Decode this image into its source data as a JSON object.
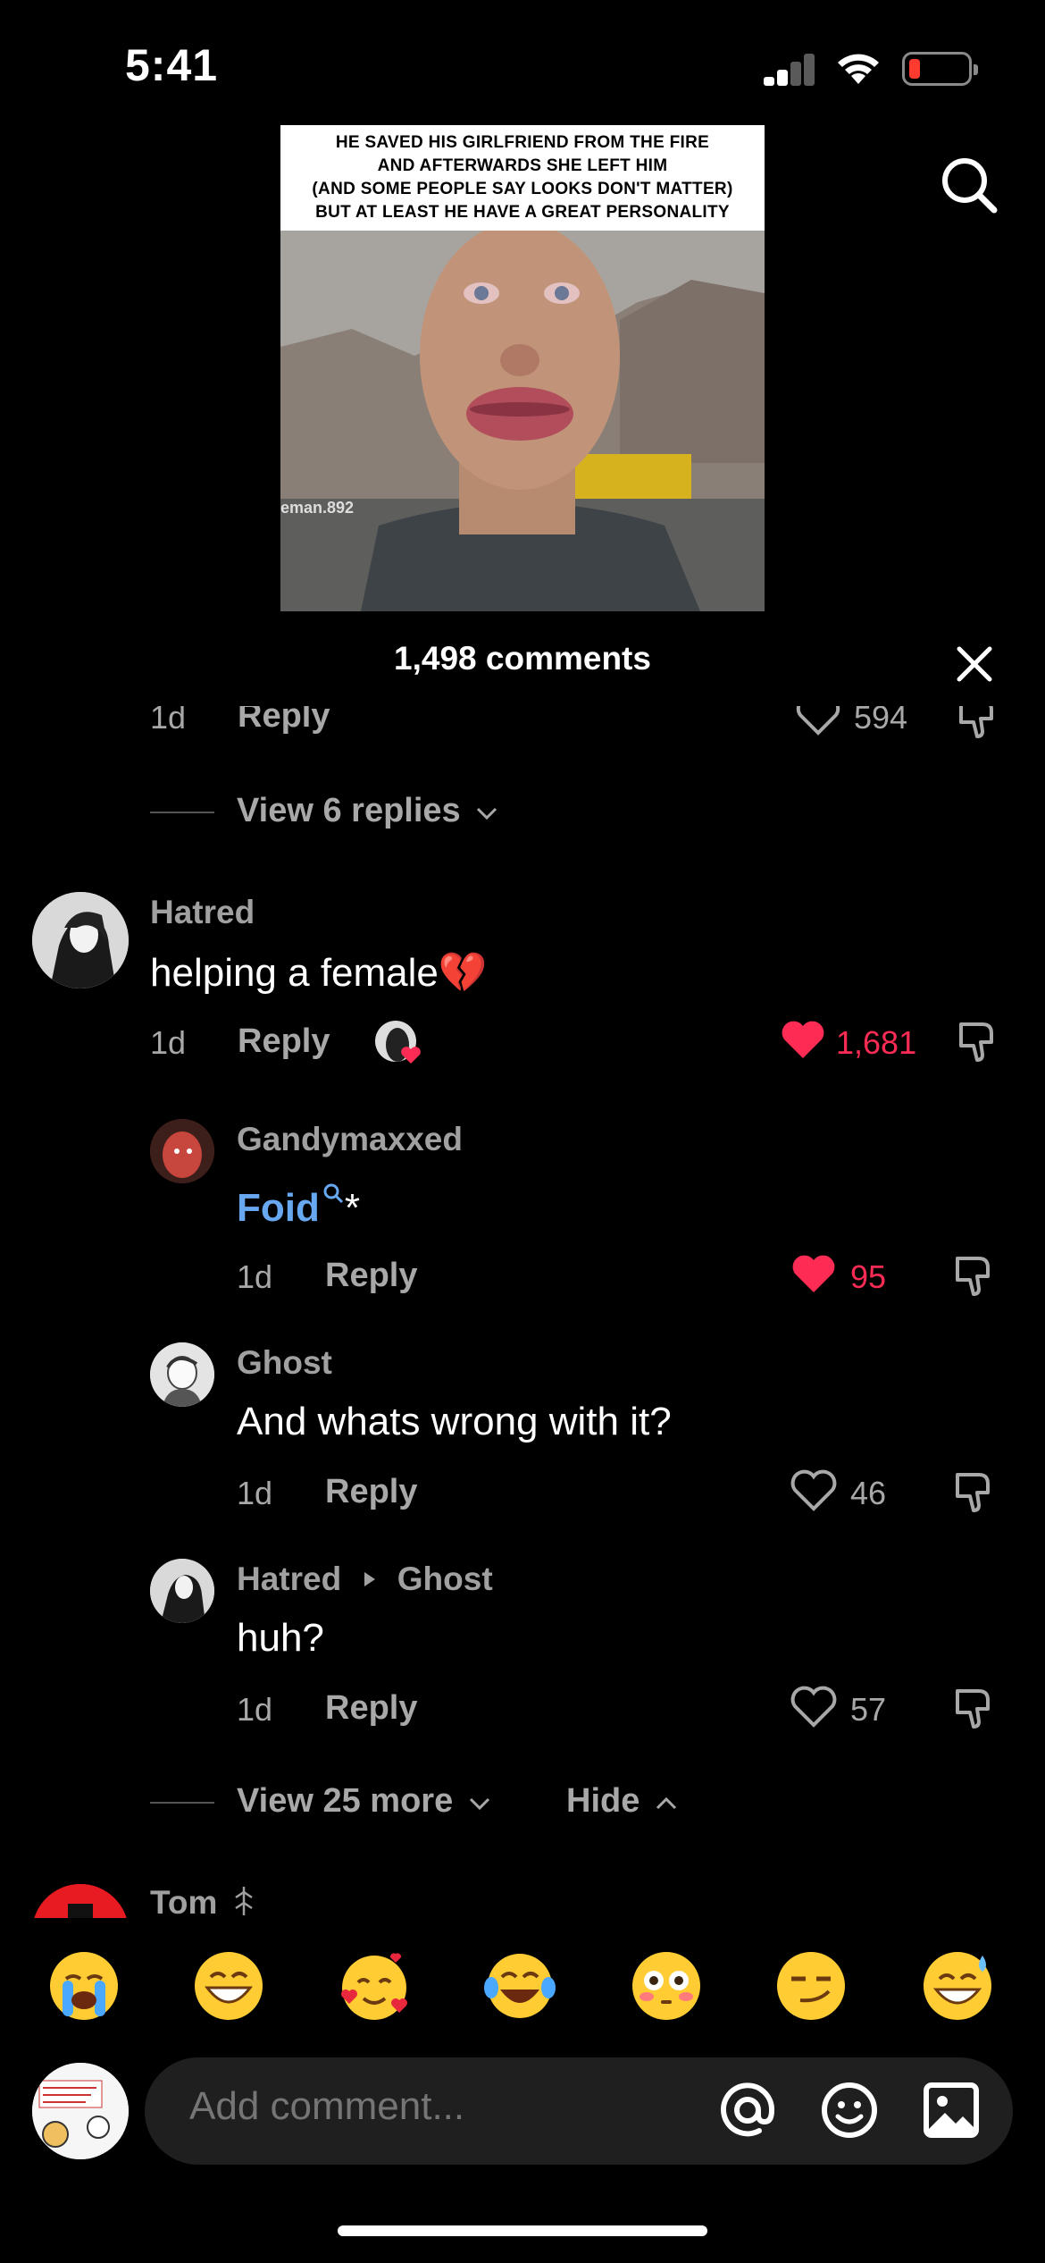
{
  "status_bar": {
    "time": "5:41",
    "battery_color": "#ff3b30"
  },
  "video": {
    "caption_lines": [
      "He saved his girlfriend from the fire",
      "and afterwards she left him",
      "(and some people say looks don't matter)",
      "but at least he have a great personality"
    ],
    "watermark": "eman.892"
  },
  "header": {
    "comments_count": "1,498 comments"
  },
  "partial_comment": {
    "time": "1d",
    "reply_label": "Reply",
    "likes": "594"
  },
  "thread_top": {
    "view_replies": "View 6 replies"
  },
  "comments": [
    {
      "username": "Hatred",
      "text": "helping a female",
      "text_emoji": "💔",
      "time": "1d",
      "reply_label": "Reply",
      "likes": "1,681",
      "liked": true
    }
  ],
  "replies": [
    {
      "username": "Gandymaxxed",
      "text": "Foid",
      "suffix": "*",
      "time": "1d",
      "reply_label": "Reply",
      "likes": "95",
      "liked": true
    },
    {
      "username": "Ghost",
      "text": "And whats wrong with it?",
      "time": "1d",
      "reply_label": "Reply",
      "likes": "46",
      "liked": false
    },
    {
      "username": "Hatred",
      "reply_to": "Ghost",
      "text": "huh?",
      "time": "1d",
      "reply_label": "Reply",
      "likes": "57",
      "liked": false
    }
  ],
  "thread_bottom": {
    "view_more": "View 25 more",
    "hide": "Hide"
  },
  "next_comment": {
    "username": "Tom"
  },
  "emoji_bar": [
    "😭",
    "😁",
    "🥰",
    "😂",
    "😳",
    "😏",
    "😅"
  ],
  "composer": {
    "placeholder": "Add comment..."
  },
  "colors": {
    "accent_like": "#fe2c55",
    "link_blue": "#68a8f0"
  }
}
